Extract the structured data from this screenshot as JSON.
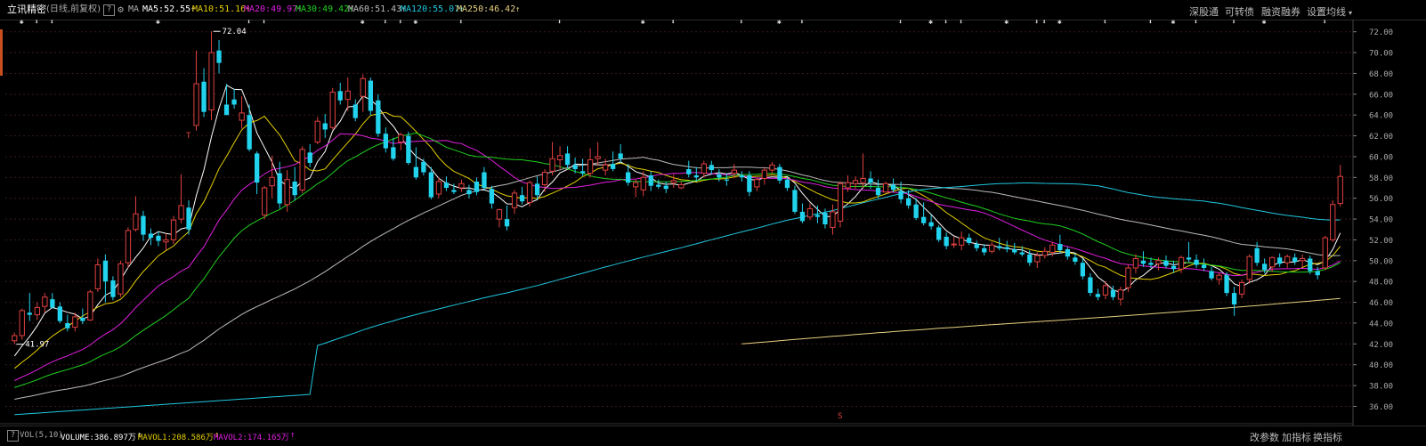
{
  "header": {
    "stock_name": "立讯精密",
    "period": "(日线,前复权)",
    "help_label": "?",
    "ma_label": "MA",
    "indicators": [
      {
        "label": "MA5:52.55",
        "color": "#ffffff"
      },
      {
        "label": "MA10:51.16",
        "color": "#e6d000"
      },
      {
        "label": "MA20:49.97",
        "color": "#e020e0"
      },
      {
        "label": "MA30:49.42",
        "color": "#20d020"
      },
      {
        "label": "MA60:51.43",
        "color": "#bbbbbb"
      },
      {
        "label": "MA120:55.07",
        "color": "#20c8e0"
      },
      {
        "label": "MA250:46.42",
        "color": "#e6d080"
      }
    ],
    "buttons": [
      "深股通",
      "可转债",
      "融资融券",
      "设置均线"
    ],
    "dropdown_icon": "caret-down-icon"
  },
  "footer": {
    "vol_label": "VOL(5,10)",
    "items": [
      {
        "label": "VOLUME:386.897万",
        "color": "#ffffff"
      },
      {
        "label": "MAVOL1:208.586万",
        "color": "#e6d000"
      },
      {
        "label": "MAVOL2:174.165万",
        "color": "#e020e0"
      }
    ],
    "buttons": [
      "改参数",
      "加指标",
      "换指标"
    ]
  },
  "chart_data": {
    "type": "candlestick",
    "title": "立讯精密 (日线,前复权)",
    "ylim": [
      34.5,
      73.0
    ],
    "y_ticks": [
      "72.00",
      "70.00",
      "68.00",
      "66.00",
      "64.00",
      "62.00",
      "60.00",
      "58.00",
      "56.00",
      "54.00",
      "52.00",
      "50.00",
      "48.00",
      "46.00",
      "44.00",
      "42.00",
      "40.00",
      "38.00",
      "36.00"
    ],
    "annotations": [
      {
        "text": "72.04",
        "note": "max"
      },
      {
        "text": "41.97",
        "note": "min"
      }
    ],
    "candles": [
      [
        42.3,
        43.1,
        41.97,
        42.8
      ],
      [
        42.8,
        45.4,
        42.4,
        45.2
      ],
      [
        45.0,
        46.9,
        44.2,
        44.8
      ],
      [
        44.8,
        46.0,
        44.3,
        45.5
      ],
      [
        45.6,
        46.9,
        45.0,
        46.5
      ],
      [
        46.3,
        46.9,
        45.4,
        45.5
      ],
      [
        45.6,
        46.0,
        44.0,
        44.2
      ],
      [
        44.0,
        44.8,
        43.2,
        43.5
      ],
      [
        43.6,
        45.0,
        43.2,
        44.6
      ],
      [
        44.5,
        45.4,
        43.9,
        44.2
      ],
      [
        44.3,
        47.2,
        44.2,
        47.0
      ],
      [
        47.3,
        50.2,
        47.0,
        49.6
      ],
      [
        50.0,
        50.6,
        46.0,
        48.0
      ],
      [
        48.1,
        48.5,
        46.2,
        46.5
      ],
      [
        46.8,
        50.0,
        46.5,
        49.7
      ],
      [
        49.8,
        53.2,
        49.3,
        52.9
      ],
      [
        53.0,
        56.2,
        52.8,
        54.5
      ],
      [
        54.3,
        54.8,
        51.9,
        52.5
      ],
      [
        52.6,
        53.1,
        51.5,
        52.2
      ],
      [
        52.4,
        52.8,
        51.4,
        51.9
      ],
      [
        51.8,
        52.6,
        51.0,
        52.0
      ],
      [
        52.0,
        54.3,
        51.6,
        53.9
      ],
      [
        54.0,
        58.3,
        53.6,
        55.3
      ],
      [
        55.1,
        55.8,
        52.5,
        53.0
      ],
      [
        63.0,
        70.2,
        62.5,
        67.0
      ],
      [
        67.2,
        68.5,
        63.8,
        64.3
      ],
      [
        64.5,
        72.04,
        63.5,
        70.0
      ],
      [
        70.2,
        71.2,
        68.0,
        69.0
      ],
      [
        65.0,
        67.0,
        64.0,
        64.0
      ],
      [
        65.5,
        66.5,
        64.6,
        65.0
      ],
      [
        63.5,
        65.8,
        62.7,
        64.2
      ],
      [
        64.0,
        65.0,
        60.5,
        60.7
      ],
      [
        60.3,
        60.5,
        56.4,
        57.5
      ],
      [
        54.4,
        57.2,
        54.0,
        57.0
      ],
      [
        57.2,
        60.1,
        56.0,
        58.0
      ],
      [
        58.4,
        59.5,
        55.0,
        55.5
      ],
      [
        55.4,
        58.7,
        54.7,
        57.8
      ],
      [
        57.6,
        59.0,
        55.8,
        56.3
      ],
      [
        56.8,
        61.0,
        56.5,
        60.7
      ],
      [
        60.4,
        61.2,
        59.0,
        59.4
      ],
      [
        61.4,
        63.8,
        61.2,
        63.4
      ],
      [
        63.2,
        64.1,
        61.8,
        62.6
      ],
      [
        62.8,
        66.6,
        62.6,
        66.2
      ],
      [
        66.3,
        67.1,
        65.0,
        65.4
      ],
      [
        65.5,
        67.6,
        64.4,
        66.3
      ],
      [
        65.0,
        65.5,
        63.4,
        63.7
      ],
      [
        65.8,
        67.9,
        64.3,
        67.5
      ],
      [
        67.3,
        67.6,
        64.0,
        64.4
      ],
      [
        65.4,
        66.0,
        61.9,
        62.2
      ],
      [
        62.2,
        62.8,
        60.4,
        60.8
      ],
      [
        60.9,
        61.8,
        59.6,
        59.8
      ],
      [
        61.4,
        62.3,
        60.6,
        62.1
      ],
      [
        62.0,
        62.4,
        59.2,
        59.4
      ],
      [
        59.0,
        60.9,
        57.8,
        58.0
      ],
      [
        59.5,
        59.8,
        58.2,
        58.5
      ],
      [
        58.5,
        59.0,
        55.9,
        56.1
      ],
      [
        56.4,
        58.0,
        56.0,
        57.6
      ],
      [
        57.5,
        58.1,
        56.7,
        57.0
      ],
      [
        56.8,
        57.4,
        56.4,
        56.6
      ],
      [
        57.0,
        57.8,
        56.6,
        57.4
      ],
      [
        56.8,
        57.3,
        56.0,
        56.4
      ],
      [
        57.6,
        58.0,
        56.3,
        56.6
      ],
      [
        58.5,
        59.0,
        56.8,
        57.0
      ],
      [
        56.9,
        57.2,
        55.0,
        55.5
      ],
      [
        54.0,
        55.0,
        53.2,
        54.9
      ],
      [
        54.0,
        55.3,
        52.9,
        53.3
      ],
      [
        55.1,
        56.8,
        54.5,
        56.5
      ],
      [
        56.3,
        57.1,
        55.4,
        55.7
      ],
      [
        55.6,
        57.7,
        55.2,
        57.5
      ],
      [
        57.4,
        58.1,
        55.9,
        56.3
      ],
      [
        57.3,
        58.8,
        56.6,
        58.5
      ],
      [
        58.6,
        61.4,
        58.2,
        59.8
      ],
      [
        59.7,
        61.0,
        58.8,
        60.1
      ],
      [
        60.3,
        61.0,
        58.9,
        59.2
      ],
      [
        59.2,
        59.9,
        58.4,
        58.8
      ],
      [
        58.6,
        59.8,
        58.1,
        58.4
      ],
      [
        58.4,
        60.8,
        58.0,
        59.7
      ],
      [
        59.8,
        61.4,
        59.1,
        60.0
      ],
      [
        58.7,
        59.8,
        58.2,
        59.2
      ],
      [
        59.3,
        60.5,
        58.6,
        58.8
      ],
      [
        60.3,
        61.2,
        59.4,
        59.8
      ],
      [
        58.5,
        59.3,
        57.2,
        57.5
      ],
      [
        57.1,
        57.8,
        56.1,
        57.5
      ],
      [
        56.8,
        58.6,
        56.2,
        58.0
      ],
      [
        58.2,
        58.6,
        56.7,
        57.2
      ],
      [
        57.3,
        57.8,
        56.9,
        57.1
      ],
      [
        57.2,
        57.6,
        56.5,
        56.9
      ],
      [
        57.5,
        58.3,
        57.0,
        57.7
      ],
      [
        57.0,
        57.6,
        56.9,
        57.3
      ],
      [
        58.8,
        59.6,
        58.0,
        58.3
      ],
      [
        58.2,
        59.0,
        57.6,
        58.0
      ],
      [
        58.4,
        59.6,
        58.0,
        59.3
      ],
      [
        59.2,
        59.6,
        58.3,
        58.7
      ],
      [
        58.3,
        58.8,
        57.6,
        58.0
      ],
      [
        57.8,
        58.4,
        57.2,
        57.7
      ],
      [
        58.4,
        59.3,
        57.9,
        58.7
      ],
      [
        58.2,
        58.6,
        57.6,
        58.0
      ],
      [
        58.2,
        58.6,
        56.2,
        56.6
      ],
      [
        57.1,
        58.0,
        56.7,
        57.8
      ],
      [
        57.9,
        59.0,
        57.3,
        58.7
      ],
      [
        58.7,
        59.5,
        58.4,
        59.2
      ],
      [
        59.0,
        59.3,
        57.4,
        57.7
      ],
      [
        57.8,
        58.0,
        56.7,
        57.0
      ],
      [
        56.8,
        57.2,
        54.5,
        54.7
      ],
      [
        54.7,
        55.5,
        53.6,
        53.8
      ],
      [
        54.2,
        55.5,
        53.9,
        55.0
      ],
      [
        54.4,
        55.3,
        53.6,
        54.2
      ],
      [
        54.6,
        55.0,
        53.1,
        53.5
      ],
      [
        53.2,
        55.4,
        52.5,
        54.7
      ],
      [
        53.8,
        57.6,
        53.2,
        57.4
      ],
      [
        57.0,
        58.2,
        56.6,
        57.5
      ],
      [
        57.4,
        58.1,
        56.9,
        57.7
      ],
      [
        57.5,
        60.3,
        57.0,
        57.9
      ],
      [
        57.9,
        58.6,
        56.9,
        57.5
      ],
      [
        57.0,
        57.8,
        56.0,
        56.3
      ],
      [
        56.6,
        57.6,
        56.5,
        57.4
      ],
      [
        57.3,
        57.9,
        56.6,
        56.8
      ],
      [
        56.7,
        57.6,
        55.5,
        55.9
      ],
      [
        56.0,
        56.8,
        55.0,
        55.3
      ],
      [
        55.4,
        56.0,
        53.9,
        54.1
      ],
      [
        54.2,
        55.6,
        53.4,
        53.6
      ],
      [
        53.7,
        54.4,
        53.0,
        53.3
      ],
      [
        53.2,
        53.4,
        51.8,
        52.0
      ],
      [
        52.3,
        52.7,
        51.1,
        51.4
      ],
      [
        51.6,
        52.3,
        51.2,
        51.6
      ],
      [
        51.5,
        52.8,
        51.0,
        52.2
      ],
      [
        52.2,
        52.6,
        51.5,
        51.7
      ],
      [
        51.6,
        51.9,
        50.9,
        51.2
      ],
      [
        51.2,
        51.6,
        50.5,
        50.8
      ],
      [
        50.9,
        51.8,
        50.7,
        51.5
      ],
      [
        51.4,
        52.2,
        51.0,
        51.2
      ],
      [
        51.3,
        51.9,
        50.8,
        51.1
      ],
      [
        51.1,
        51.7,
        50.6,
        50.8
      ],
      [
        50.8,
        51.4,
        50.4,
        50.6
      ],
      [
        50.6,
        51.0,
        49.5,
        49.8
      ],
      [
        49.9,
        50.8,
        49.3,
        50.5
      ],
      [
        50.5,
        51.3,
        50.2,
        50.9
      ],
      [
        50.8,
        51.8,
        50.4,
        51.5
      ],
      [
        51.6,
        52.5,
        50.7,
        51.0
      ],
      [
        51.1,
        51.3,
        50.1,
        50.4
      ],
      [
        50.3,
        50.7,
        49.6,
        49.9
      ],
      [
        49.8,
        50.2,
        48.2,
        48.5
      ],
      [
        48.4,
        48.8,
        46.6,
        46.9
      ],
      [
        46.8,
        47.3,
        46.2,
        46.5
      ],
      [
        46.7,
        48.0,
        46.3,
        47.6
      ],
      [
        47.2,
        47.6,
        46.2,
        46.5
      ],
      [
        46.3,
        47.5,
        45.7,
        47.2
      ],
      [
        47.4,
        49.6,
        47.0,
        49.3
      ],
      [
        49.3,
        50.6,
        48.8,
        50.2
      ],
      [
        50.0,
        50.9,
        49.4,
        49.7
      ],
      [
        49.8,
        50.3,
        49.3,
        49.6
      ],
      [
        49.7,
        50.3,
        49.1,
        50.0
      ],
      [
        50.0,
        50.5,
        49.3,
        49.5
      ],
      [
        49.5,
        50.0,
        48.8,
        49.2
      ],
      [
        49.2,
        50.5,
        48.8,
        50.3
      ],
      [
        50.3,
        51.8,
        49.9,
        50.1
      ],
      [
        50.1,
        50.6,
        49.3,
        49.6
      ],
      [
        49.6,
        50.2,
        49.0,
        49.3
      ],
      [
        49.0,
        49.4,
        48.1,
        48.3
      ],
      [
        48.2,
        48.8,
        47.7,
        48.6
      ],
      [
        48.6,
        48.9,
        46.6,
        46.9
      ],
      [
        46.9,
        47.5,
        44.7,
        45.8
      ],
      [
        46.8,
        48.2,
        46.4,
        47.9
      ],
      [
        48.2,
        50.6,
        47.8,
        50.4
      ],
      [
        51.2,
        51.8,
        49.5,
        49.8
      ],
      [
        49.7,
        50.2,
        48.8,
        49.1
      ],
      [
        49.4,
        50.4,
        48.9,
        50.3
      ],
      [
        50.3,
        50.7,
        49.4,
        49.7
      ],
      [
        49.8,
        50.6,
        49.3,
        50.4
      ],
      [
        50.3,
        50.7,
        49.6,
        49.9
      ],
      [
        50.0,
        50.6,
        49.4,
        50.2
      ],
      [
        50.2,
        50.5,
        48.7,
        49.0
      ],
      [
        49.0,
        49.4,
        48.2,
        48.6
      ],
      [
        49.3,
        52.4,
        49.1,
        52.2
      ],
      [
        52.0,
        55.8,
        51.8,
        55.4
      ],
      [
        55.5,
        59.2,
        55.2,
        58.1
      ]
    ],
    "series": [
      {
        "name": "MA5",
        "color": "#ffffff",
        "values": []
      },
      {
        "name": "MA10",
        "color": "#e6d000",
        "values": []
      },
      {
        "name": "MA20",
        "color": "#e020e0",
        "values": []
      },
      {
        "name": "MA30",
        "color": "#20d020",
        "values": []
      },
      {
        "name": "MA60",
        "color": "#bbbbbb",
        "values": []
      },
      {
        "name": "MA120",
        "color": "#20c8e0",
        "values": []
      },
      {
        "name": "MA250",
        "color": "#e6d080",
        "values": []
      }
    ],
    "colors": {
      "up": "#e04040",
      "down": "#22d3ee",
      "grid": "#3a1a1a",
      "axis_text": "#aaaaaa",
      "background": "#000000"
    },
    "grid": true
  }
}
